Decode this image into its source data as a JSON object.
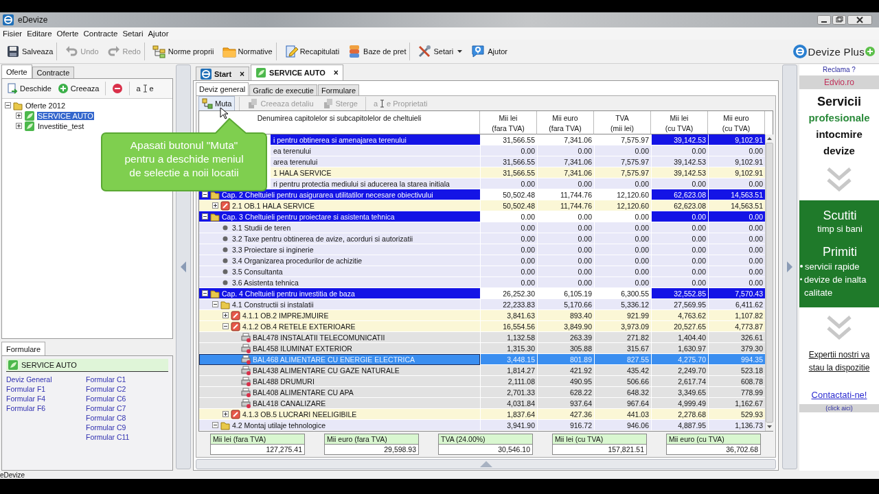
{
  "window": {
    "title": "eDevize"
  },
  "menu": [
    "Fisier",
    "Editare",
    "Oferte",
    "Contracte",
    "Setari",
    "Ajutor"
  ],
  "toolbar": [
    {
      "kind": "save",
      "label": "Salveaza",
      "disabled": false,
      "separator_after": true
    },
    {
      "kind": "undo",
      "label": "Undo",
      "disabled": true,
      "separator_after": false
    },
    {
      "kind": "redo",
      "label": "Redo",
      "disabled": true,
      "separator_after": true
    },
    {
      "kind": "tree",
      "label": "Norme proprii",
      "disabled": false,
      "separator_after": false
    },
    {
      "kind": "folder",
      "label": "Normative",
      "disabled": false,
      "separator_after": true
    },
    {
      "kind": "edit",
      "label": "Recapitulati",
      "disabled": false,
      "separator_after": false
    },
    {
      "kind": "database",
      "label": "Baze de pret",
      "disabled": false,
      "separator_after": true
    },
    {
      "kind": "tools",
      "label": "Setari",
      "disabled": false,
      "separator_after": false,
      "dropdown": true
    },
    {
      "kind": "help",
      "label": "Ajutor",
      "disabled": false,
      "separator_after": false
    }
  ],
  "left_panel": {
    "tabs": [
      {
        "label": "Oferte",
        "selected": true
      },
      {
        "label": "Contracte",
        "selected": false
      }
    ],
    "toolbar": [
      {
        "kind": "open",
        "label": "Deschide"
      },
      {
        "kind": "create",
        "label": "Creeaza"
      },
      {
        "kind": "delete"
      },
      {
        "kind": "rename",
        "glyph_left": "a",
        "glyph_right": "e"
      }
    ],
    "tree": [
      {
        "label": "Oferte 2012",
        "kind": "folder",
        "selected": false,
        "expanded": true,
        "children": [
          {
            "label": "SERVICE AUTO",
            "kind": "offer",
            "selected": true,
            "expanded": false
          },
          {
            "label": "Investitie_test",
            "kind": "offer",
            "selected": false,
            "expanded": false
          }
        ]
      }
    ]
  },
  "forms_panel": {
    "tabs": [
      {
        "label": "Formulare",
        "selected": true
      }
    ],
    "header": "SERVICE AUTO",
    "column_1": [
      "Deviz General",
      "Formular F1",
      "Formular F4",
      "Formular F6"
    ],
    "column_2": [
      "Formular C1",
      "Formular C2",
      "Formular C6",
      "Formular C7",
      "Formular C8",
      "Formular C9",
      "Formular C11"
    ]
  },
  "document_tabs": [
    {
      "kind": "start",
      "label": "Start",
      "close": "×",
      "selected": false
    },
    {
      "kind": "offer",
      "label": "SERVICE AUTO",
      "close": "×",
      "selected": true
    }
  ],
  "view_tabs": [
    {
      "label": "Deviz general",
      "selected": true
    },
    {
      "label": "Grafic de executie",
      "selected": false
    },
    {
      "label": "Formulare",
      "selected": false
    }
  ],
  "actions": [
    {
      "kind": "move",
      "label": "Muta",
      "disabled": false,
      "hovered": true
    },
    {
      "kind": "detail",
      "label": "Creeaza detaliu",
      "disabled": true,
      "hovered": false
    },
    {
      "kind": "remove",
      "label": "Sterge",
      "disabled": true,
      "hovered": false
    },
    {
      "kind": "rename",
      "label": "Proprietati",
      "disabled": true,
      "hovered": false,
      "glyph_left": "a",
      "glyph_right": "e"
    }
  ],
  "table": {
    "columns": [
      {
        "lines": [
          "Denumirea capitolelor si subcapitolelor de cheltuieli"
        ]
      },
      {
        "lines": [
          "Mii lei",
          "(fara TVA)"
        ]
      },
      {
        "lines": [
          "Mii euro",
          "(fara TVA)"
        ]
      },
      {
        "lines": [
          "TVA",
          "(mii lei)"
        ]
      },
      {
        "lines": [
          "Mii lei",
          "(cu TVA)"
        ]
      },
      {
        "lines": [
          "Mii euro",
          "(cu TVA)"
        ]
      }
    ],
    "rows": [
      {
        "kind": "chapter",
        "name": "i pentru obtinerea si amenajarea terenului",
        "clipped": true,
        "selected": false,
        "expanded": true,
        "values": [
          "31,566.55",
          "7,341.06",
          "7,575.97",
          "39,142.53",
          "9,102.91"
        ],
        "children": [
          {
            "kind": "section",
            "name": "ea terenului",
            "clipped": true,
            "selected": false,
            "values": [
              "0.00",
              "0.00",
              "0.00",
              "0.00",
              "0.00"
            ]
          },
          {
            "kind": "section",
            "name": "area terenului",
            "clipped": true,
            "selected": false,
            "values": [
              "31,566.55",
              "7,341.06",
              "7,575.97",
              "39,142.53",
              "9,102.91"
            ]
          },
          {
            "kind": "object",
            "name": "1 HALA SERVICE",
            "clipped": true,
            "selected": false,
            "values": [
              "31,566.55",
              "7,341.06",
              "7,575.97",
              "39,142.53",
              "9,102.91"
            ]
          },
          {
            "kind": "section",
            "name": "ri pentru protectia mediului si aducerea la starea initiala",
            "clipped": true,
            "selected": false,
            "values": [
              "0.00",
              "0.00",
              "0.00",
              "0.00",
              "0.00"
            ]
          }
        ]
      },
      {
        "kind": "chapter",
        "name": "Cap. 2 Cheltuieli pentru asigurarea utilitatilor necesare obiectivului",
        "clipped": false,
        "selected": false,
        "expanded": true,
        "values": [
          "50,502.48",
          "11,744.76",
          "12,120.60",
          "62,623.08",
          "14,563.51"
        ],
        "children": [
          {
            "kind": "object",
            "name": "2.1 OB.1 HALA SERVICE",
            "clipped": false,
            "selected": false,
            "expanded": false,
            "values": [
              "50,502.48",
              "11,744.76",
              "12,120.60",
              "62,623.08",
              "14,563.51"
            ]
          }
        ]
      },
      {
        "kind": "chapter",
        "name": "Cap. 3 Cheltuieli pentru proiectare si asistenta tehnica",
        "clipped": false,
        "selected": false,
        "expanded": true,
        "values": [
          "0.00",
          "0.00",
          "0.00",
          "0.00",
          "0.00"
        ],
        "children": [
          {
            "kind": "bullet",
            "name": "3.1 Studii de teren",
            "clipped": false,
            "selected": false,
            "values": [
              "0.00",
              "0.00",
              "0.00",
              "0.00",
              "0.00"
            ]
          },
          {
            "kind": "bullet",
            "name": "3.2 Taxe pentru obtinerea de avize, acorduri si autorizatii",
            "clipped": false,
            "selected": false,
            "values": [
              "0.00",
              "0.00",
              "0.00",
              "0.00",
              "0.00"
            ]
          },
          {
            "kind": "bullet",
            "name": "3.3 Proiectare si inginerie",
            "clipped": false,
            "selected": false,
            "values": [
              "0.00",
              "0.00",
              "0.00",
              "0.00",
              "0.00"
            ]
          },
          {
            "kind": "bullet",
            "name": "3.4 Organizarea procedurilor de achizitie",
            "clipped": false,
            "selected": false,
            "values": [
              "0.00",
              "0.00",
              "0.00",
              "0.00",
              "0.00"
            ]
          },
          {
            "kind": "bullet",
            "name": "3.5 Consultanta",
            "clipped": false,
            "selected": false,
            "values": [
              "0.00",
              "0.00",
              "0.00",
              "0.00",
              "0.00"
            ]
          },
          {
            "kind": "bullet",
            "name": "3.6 Asistenta tehnica",
            "clipped": false,
            "selected": false,
            "values": [
              "0.00",
              "0.00",
              "0.00",
              "0.00",
              "0.00"
            ]
          }
        ]
      },
      {
        "kind": "chapter",
        "name": "Cap. 4 Cheltuieli pentru investitia de baza",
        "clipped": false,
        "selected": false,
        "expanded": true,
        "values": [
          "26,252.30",
          "6,105.19",
          "6,300.55",
          "32,552.85",
          "7,570.43"
        ],
        "children": [
          {
            "kind": "section",
            "name": "4.1 Constructii si instalatii",
            "clipped": false,
            "selected": false,
            "expanded": true,
            "values": [
              "22,233.83",
              "5,170.66",
              "5,336.12",
              "27,569.95",
              "6,411.62"
            ],
            "children": [
              {
                "kind": "object",
                "name": "4.1.1 OB.2 IMPREJMUIRE",
                "clipped": false,
                "selected": false,
                "expanded": false,
                "values": [
                  "3,841.63",
                  "893.40",
                  "921.99",
                  "4,763.62",
                  "1,107.82"
                ]
              },
              {
                "kind": "object",
                "name": "4.1.2 OB.4 RETELE EXTERIOARE",
                "clipped": false,
                "selected": false,
                "expanded": true,
                "values": [
                  "16,554.56",
                  "3,849.90",
                  "3,973.09",
                  "20,527.65",
                  "4,773.87"
                ],
                "children": [
                  {
                    "kind": "item",
                    "name": "BAL478 INSTALATII TELECOMUNICATII",
                    "clipped": false,
                    "selected": false,
                    "values": [
                      "1,132.58",
                      "263.39",
                      "271.82",
                      "1,404.40",
                      "326.61"
                    ]
                  },
                  {
                    "kind": "item",
                    "name": "BAL458 ILUMINAT EXTERIOR",
                    "clipped": false,
                    "selected": false,
                    "values": [
                      "1,315.30",
                      "305.88",
                      "315.67",
                      "1,630.97",
                      "379.30"
                    ]
                  },
                  {
                    "kind": "item",
                    "name": "BAL468 ALIMENTARE CU ENERGIE ELECTRICA",
                    "clipped": false,
                    "selected": true,
                    "values": [
                      "3,448.15",
                      "801.89",
                      "827.55",
                      "4,275.70",
                      "994.35"
                    ]
                  },
                  {
                    "kind": "item",
                    "name": "BAL438 ALIMENTARE CU GAZE NATURALE",
                    "clipped": false,
                    "selected": false,
                    "values": [
                      "1,814.27",
                      "421.92",
                      "435.42",
                      "2,249.70",
                      "523.18"
                    ]
                  },
                  {
                    "kind": "item",
                    "name": "BAL488 DRUMURI",
                    "clipped": false,
                    "selected": false,
                    "values": [
                      "2,111.08",
                      "490.95",
                      "506.66",
                      "2,617.74",
                      "608.78"
                    ]
                  },
                  {
                    "kind": "item",
                    "name": "BAL408 ALIMENTARE CU APA",
                    "clipped": false,
                    "selected": false,
                    "values": [
                      "2,701.33",
                      "628.22",
                      "648.32",
                      "3,349.65",
                      "778.99"
                    ]
                  },
                  {
                    "kind": "item",
                    "name": "BAL418 CANALIZARE",
                    "clipped": false,
                    "selected": false,
                    "values": [
                      "4,031.84",
                      "937.64",
                      "967.64",
                      "4,999.49",
                      "1,162.67"
                    ]
                  }
                ]
              },
              {
                "kind": "object",
                "name": "4.1.3 OB.5 LUCRARI NEELIGIBILE",
                "clipped": false,
                "selected": false,
                "expanded": false,
                "values": [
                  "1,837.64",
                  "427.36",
                  "441.03",
                  "2,278.68",
                  "529.93"
                ]
              }
            ]
          },
          {
            "kind": "section",
            "name": "4.2 Montaj utilaje tehnologice",
            "clipped": false,
            "selected": false,
            "expanded": true,
            "values": [
              "3,941.90",
              "916.72",
              "946.06",
              "4,887.95",
              "1,136.73"
            ]
          }
        ]
      }
    ]
  },
  "totals": [
    {
      "label": "Mii lei (fara TVA)",
      "value": "127,275.41"
    },
    {
      "label": "Mii euro (fara TVA)",
      "value": "29,598.93"
    },
    {
      "label": "TVA (24.00%)",
      "value": "30,546.10"
    },
    {
      "label": "Mii lei (cu TVA)",
      "value": "157,821.51"
    },
    {
      "label": "Mii euro (cu TVA)",
      "value": "36,702.68"
    }
  ],
  "callout": {
    "lines": [
      "Apasati butonul \"Muta\"",
      "pentru a deschide meniul",
      "de selectie a noii locatii"
    ]
  },
  "ad": {
    "logo": "Devize Plus",
    "question": "Reclama ?",
    "site": "Edvio.ro",
    "headline": [
      {
        "kind": "title",
        "text": "Servicii"
      },
      {
        "kind": "accent",
        "text": "profesionale"
      },
      {
        "kind": "plain",
        "text": "intocmire"
      },
      {
        "kind": "plain",
        "text": "devize"
      }
    ],
    "promo": [
      {
        "kind": "big",
        "text": "Scutiti"
      },
      {
        "kind": "small",
        "text": "timp si bani"
      },
      {
        "kind": "big",
        "text": "Primiti"
      },
      {
        "kind": "bullet",
        "text": "servicii rapide"
      },
      {
        "kind": "bullet",
        "text": "devize de inalta calitate"
      }
    ],
    "experts": "Expertii nostri va stau la dispozitie",
    "contact": "Contactati-ne!",
    "click": "(click aici)"
  },
  "status_bar": {
    "text": "eDevize"
  }
}
